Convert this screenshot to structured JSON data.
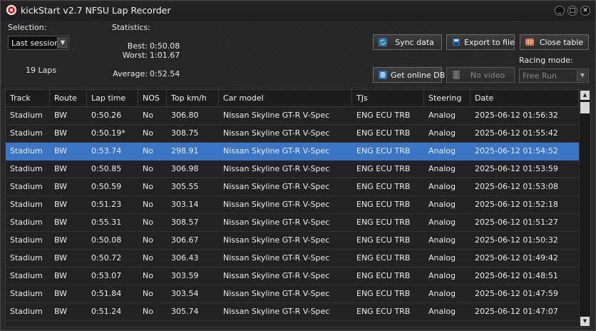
{
  "window": {
    "title": "kickStart v2.7 NFSU Lap Recorder",
    "controls": {
      "minimize": "_",
      "maximize": "□",
      "close": "✕"
    }
  },
  "selection": {
    "label": "Selection:",
    "value": "Last session",
    "laps": "19 Laps"
  },
  "statistics": {
    "label": "Statistics:",
    "best_label": "Best:",
    "best": "0:50.08",
    "worst_label": "Worst:",
    "worst": "1:01.67",
    "average_label": "Average:",
    "average": "0:52.54"
  },
  "buttons": {
    "sync": "Sync data",
    "export": "Export to file",
    "close_table": "Close table",
    "online_db": "Get online DB",
    "no_video": "No video"
  },
  "racing_mode": {
    "label": "Racing mode:",
    "value": "Free Run"
  },
  "table": {
    "columns": [
      "Track",
      "Route",
      "Lap time",
      "NOS",
      "Top km/h",
      "Car model",
      "TJs",
      "Steering",
      "Date"
    ],
    "selected_row": 2,
    "rows": [
      [
        "Stadium",
        "BW",
        "0:50.26",
        "No",
        "306.80",
        "Nissan Skyline GT-R V-Spec",
        "ENG ECU TRB",
        "Analog",
        "2025-06-12 01:56:32"
      ],
      [
        "Stadium",
        "BW",
        "0:50.19*",
        "No",
        "308.75",
        "Nissan Skyline GT-R V-Spec",
        "ENG ECU TRB",
        "Analog",
        "2025-06-12 01:55:42"
      ],
      [
        "Stadium",
        "BW",
        "0:53.74",
        "No",
        "298.91",
        "Nissan Skyline GT-R V-Spec",
        "ENG ECU TRB",
        "Analog",
        "2025-06-12 01:54:52"
      ],
      [
        "Stadium",
        "BW",
        "0:50.85",
        "No",
        "306.98",
        "Nissan Skyline GT-R V-Spec",
        "ENG ECU TRB",
        "Analog",
        "2025-06-12 01:53:59"
      ],
      [
        "Stadium",
        "BW",
        "0:50.59",
        "No",
        "305.55",
        "Nissan Skyline GT-R V-Spec",
        "ENG ECU TRB",
        "Analog",
        "2025-06-12 01:53:08"
      ],
      [
        "Stadium",
        "BW",
        "0:51.23",
        "No",
        "303.14",
        "Nissan Skyline GT-R V-Spec",
        "ENG ECU TRB",
        "Analog",
        "2025-06-12 01:52:18"
      ],
      [
        "Stadium",
        "BW",
        "0:55.31",
        "No",
        "308.57",
        "Nissan Skyline GT-R V-Spec",
        "ENG ECU TRB",
        "Analog",
        "2025-06-12 01:51:27"
      ],
      [
        "Stadium",
        "BW",
        "0:50.08",
        "No",
        "306.67",
        "Nissan Skyline GT-R V-Spec",
        "ENG ECU TRB",
        "Analog",
        "2025-06-12 01:50:32"
      ],
      [
        "Stadium",
        "BW",
        "0:50.72",
        "No",
        "306.43",
        "Nissan Skyline GT-R V-Spec",
        "ENG ECU TRB",
        "Analog",
        "2025-06-12 01:49:42"
      ],
      [
        "Stadium",
        "BW",
        "0:53.07",
        "No",
        "303.59",
        "Nissan Skyline GT-R V-Spec",
        "ENG ECU TRB",
        "Analog",
        "2025-06-12 01:48:51"
      ],
      [
        "Stadium",
        "BW",
        "0:51.84",
        "No",
        "303.54",
        "Nissan Skyline GT-R V-Spec",
        "ENG ECU TRB",
        "Analog",
        "2025-06-12 01:47:59"
      ],
      [
        "Stadium",
        "BW",
        "0:51.24",
        "No",
        "305.74",
        "Nissan Skyline GT-R V-Spec",
        "ENG ECU TRB",
        "Analog",
        "2025-06-12 01:47:07"
      ]
    ]
  },
  "colors": {
    "selected_row": "#3b74c2",
    "background": "#2a2a2a",
    "app_icon": "#e02020"
  },
  "icons": {
    "sync": "sync-icon",
    "export": "export-icon",
    "close_table": "table-icon",
    "online_db": "database-icon",
    "video": "film-icon"
  }
}
